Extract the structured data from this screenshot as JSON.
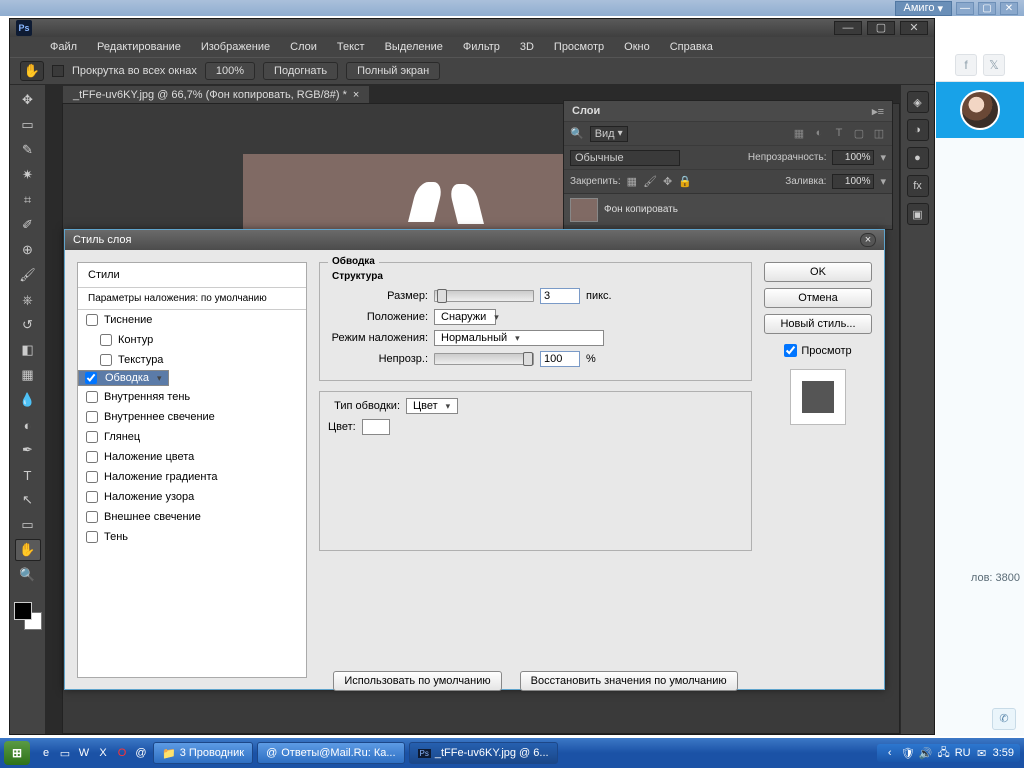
{
  "browser": {
    "menu_label": "Амиго"
  },
  "ps": {
    "menubar": [
      "Файл",
      "Редактирование",
      "Изображение",
      "Слои",
      "Текст",
      "Выделение",
      "Фильтр",
      "3D",
      "Просмотр",
      "Окно",
      "Справка"
    ],
    "optbar": {
      "scroll_all": "Прокрутка во всех окнах",
      "btn_100": "100%",
      "btn_fit": "Подогнать",
      "btn_full": "Полный экран"
    },
    "doctab": "_tFFe-uv6KY.jpg @ 66,7% (Фон копировать, RGB/8#) *"
  },
  "layers": {
    "title": "Слои",
    "kind": "Вид",
    "blend_mode": "Обычные",
    "opacity_label": "Непрозрачность:",
    "opacity": "100%",
    "lock_label": "Закрепить:",
    "fill_label": "Заливка:",
    "fill": "100%",
    "layer_name": "Фон копировать"
  },
  "dialog": {
    "title": "Стиль слоя",
    "left": {
      "styles": "Стили",
      "blend_defaults": "Параметры наложения: по умолчанию",
      "effects": [
        "Тиснение",
        "Контур",
        "Текстура",
        "Обводка",
        "Внутренняя тень",
        "Внутреннее свечение",
        "Глянец",
        "Наложение цвета",
        "Наложение градиента",
        "Наложение узора",
        "Внешнее свечение",
        "Тень"
      ]
    },
    "mid": {
      "group_title": "Обводка",
      "structure": "Структура",
      "size_label": "Размер:",
      "size_value": "3",
      "size_unit": "пикс.",
      "position_label": "Положение:",
      "position_value": "Снаружи",
      "blend_label": "Режим наложения:",
      "blend_value": "Нормальный",
      "opacity_label": "Непрозр.:",
      "opacity_value": "100",
      "opacity_unit": "%",
      "filltype_label": "Тип обводки:",
      "filltype_value": "Цвет",
      "color_label": "Цвет:",
      "make_default": "Использовать по умолчанию",
      "reset_default": "Восстановить значения по умолчанию"
    },
    "right": {
      "ok": "OK",
      "cancel": "Отмена",
      "new_style": "Новый стиль...",
      "preview": "Просмотр"
    }
  },
  "browser_right": {
    "count": "лов: 3800"
  },
  "taskbar": {
    "tasks": [
      "3 Проводник",
      "Ответы@Mail.Ru: Ка...",
      "_tFFe-uv6KY.jpg @ 6..."
    ],
    "lang": "RU",
    "time": "3:59"
  }
}
